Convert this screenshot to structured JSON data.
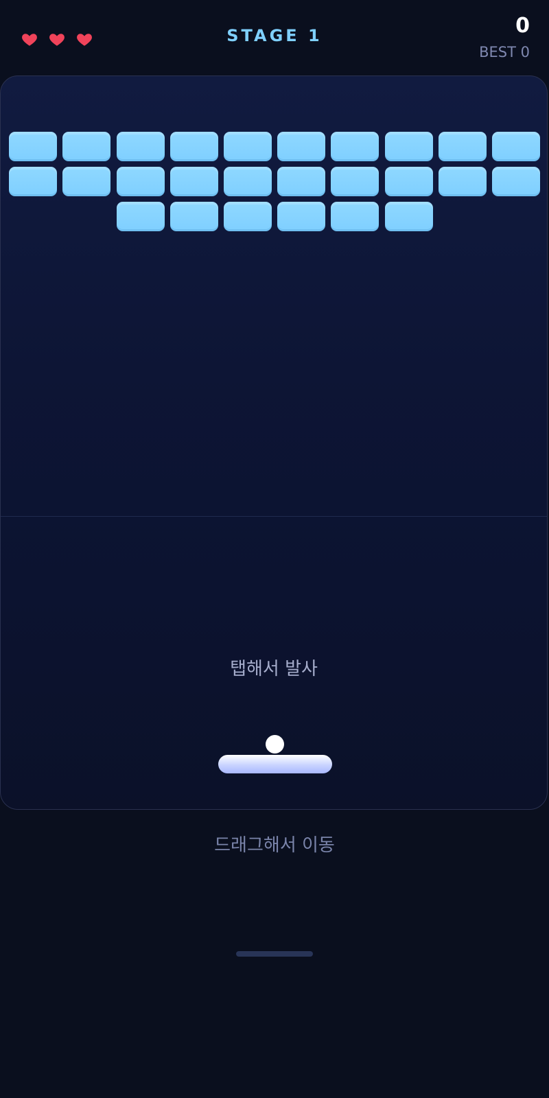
{
  "hud": {
    "lives": 3,
    "stage_label": "STAGE 1",
    "score": "0",
    "best_label": "BEST 0"
  },
  "colors": {
    "background": "#0a0f1e",
    "brick": "#7fcfff",
    "heart": "#f0435a",
    "stage_text": "#7fd0ff",
    "paddle": "#c9d4ff",
    "ball": "#ffffff"
  },
  "bricks": {
    "rows": [
      10,
      10,
      6
    ]
  },
  "field": {
    "launch_hint": "탭해서 발사"
  },
  "footer": {
    "move_hint": "드래그해서 이동"
  },
  "icons": {
    "life": "heart-icon"
  }
}
